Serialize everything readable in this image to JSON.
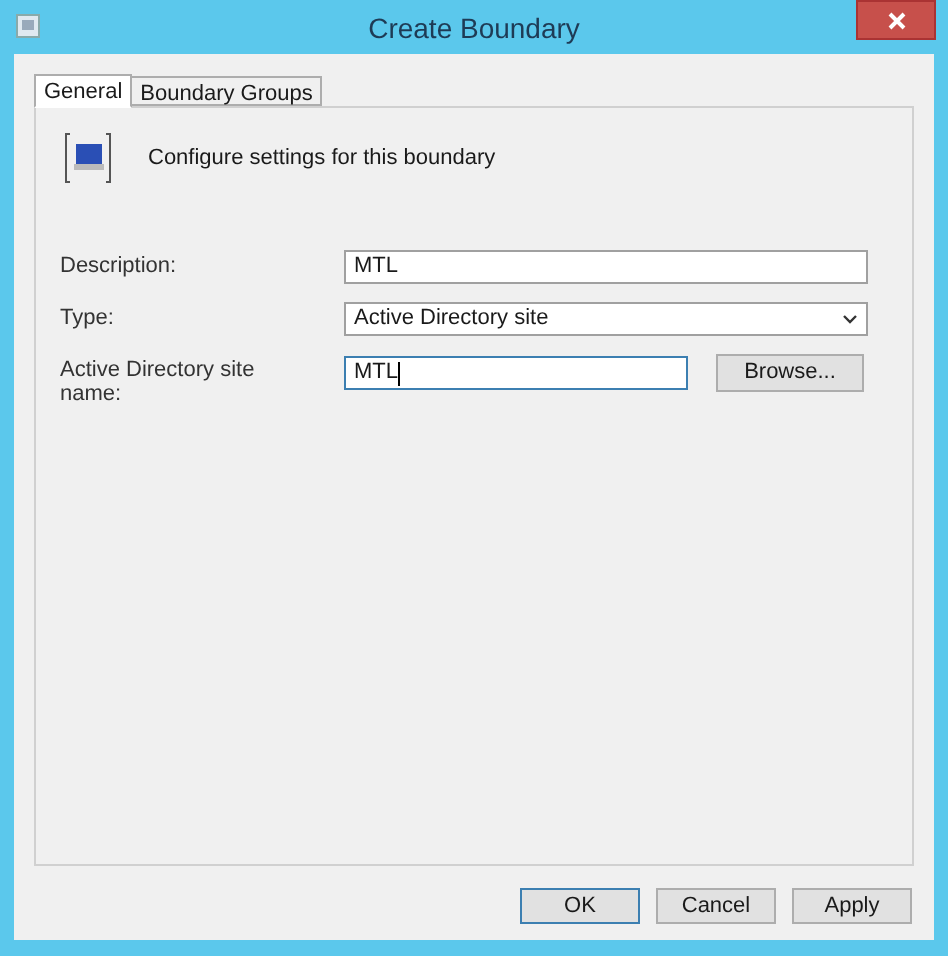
{
  "window": {
    "title": "Create Boundary"
  },
  "tabs": [
    {
      "label": "General",
      "selected": true
    },
    {
      "label": "Boundary Groups",
      "selected": false
    }
  ],
  "header": {
    "text": "Configure settings for this boundary"
  },
  "fields": [
    {
      "kind": "text",
      "label": "Description:",
      "value": "MTL",
      "focused": false
    },
    {
      "kind": "dropdown",
      "label": "Type:",
      "value": "Active Directory site",
      "focused": false
    },
    {
      "kind": "text_browse",
      "label": "Active Directory site name:",
      "value": "MTL",
      "focused": true,
      "button": "Browse..."
    }
  ],
  "buttons": [
    {
      "label": "OK",
      "default": true
    },
    {
      "label": "Cancel",
      "default": false
    },
    {
      "label": "Apply",
      "default": false
    }
  ]
}
